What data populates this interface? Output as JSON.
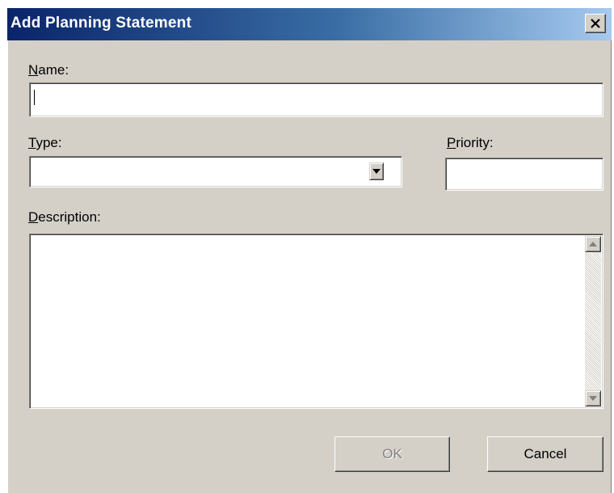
{
  "dialog": {
    "title": "Add Planning Statement",
    "close_icon": "close-icon"
  },
  "fields": {
    "name": {
      "label_accel": "N",
      "label_rest": "ame:",
      "value": ""
    },
    "type": {
      "label_accel": "T",
      "label_rest": "ype:",
      "selected": ""
    },
    "priority": {
      "label_accel": "P",
      "label_rest": "riority:",
      "value": ""
    },
    "description": {
      "label_accel": "D",
      "label_rest": "escription:",
      "value": ""
    }
  },
  "buttons": {
    "ok_label": "OK",
    "ok_enabled": false,
    "cancel_label": "Cancel"
  },
  "icons": {
    "dropdown": "chevron-down-icon",
    "scroll_up": "scroll-up-arrow-icon",
    "scroll_down": "scroll-down-arrow-icon"
  },
  "colors": {
    "face": "#d4d0c8",
    "title_start": "#0a246a",
    "title_end": "#a6caf0",
    "field_bg": "#ffffff"
  }
}
